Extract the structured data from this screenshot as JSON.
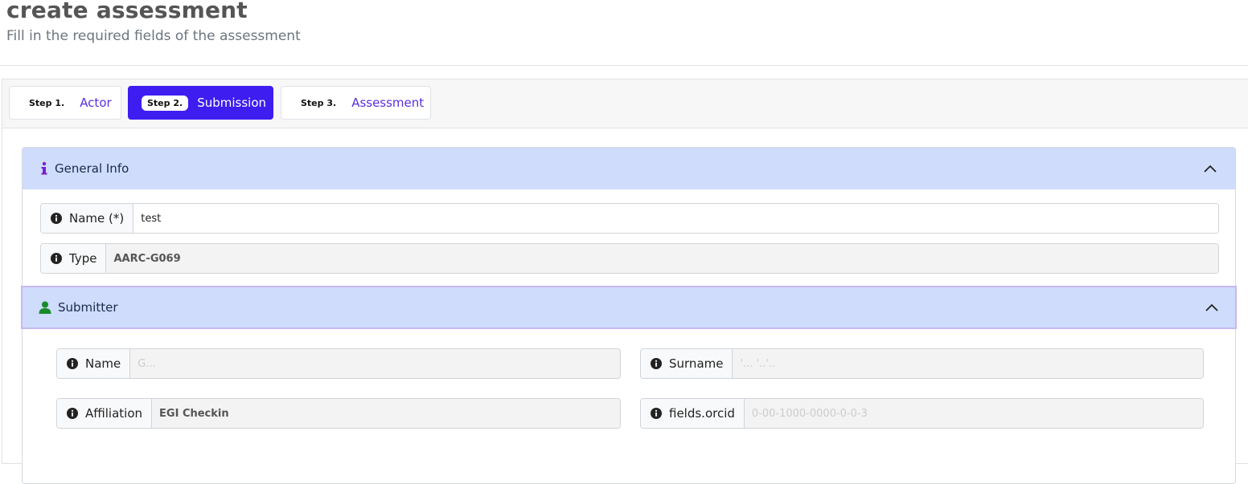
{
  "header": {
    "title": "create assessment",
    "subtitle": "Fill in the required fields of the assessment"
  },
  "steps": [
    {
      "num": "Step 1.",
      "label": "Actor",
      "active": false
    },
    {
      "num": "Step 2.",
      "label": "Submission",
      "active": true
    },
    {
      "num": "Step 3.",
      "label": "Assessment",
      "active": false
    }
  ],
  "general_info": {
    "title": "General Info",
    "name_label": "Name (*)",
    "name_value": "test",
    "type_label": "Type",
    "type_value": "AARC-G069"
  },
  "submitter": {
    "title": "Submitter",
    "name_label": "Name",
    "name_value": "G...",
    "surname_label": "Surname",
    "surname_value": "'... '..'..",
    "affiliation_label": "Affiliation",
    "affiliation_value": "EGI Checkin",
    "orcid_label": "fields.orcid",
    "orcid_value": "0-00-1000-0000-0-0-3"
  },
  "colors": {
    "accent": "#3d1df0",
    "section_header": "#cfdcfb",
    "info_icon": "#7b1fd1",
    "user_icon": "#198a2a"
  },
  "icons": [
    "info-i-icon",
    "user-icon",
    "chevron-up-icon",
    "info-circle-icon"
  ]
}
